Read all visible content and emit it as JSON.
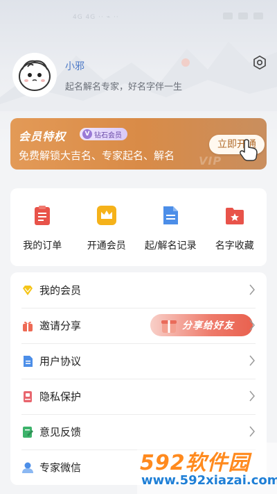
{
  "status_bar": {
    "left_text": "4G  4G  ·· ⌁ ··"
  },
  "profile": {
    "username": "小邪",
    "tagline": "起名解名专家，好名字伴一生"
  },
  "vip_banner": {
    "title": "会员特权",
    "badge": "钻石会员",
    "badge_icon": "V",
    "description": "免费解锁大吉名、专家起名、解名",
    "button": "立即开通",
    "watermark": "VIP"
  },
  "quick_actions": [
    {
      "label": "我的订单",
      "icon": "clipboard-icon",
      "color": "#e8534a"
    },
    {
      "label": "开通会员",
      "icon": "crown-icon",
      "color": "#f5b21a"
    },
    {
      "label": "起/解名记录",
      "icon": "document-icon",
      "color": "#4c8ee8"
    },
    {
      "label": "名字收藏",
      "icon": "folder-star-icon",
      "color": "#e8534a"
    }
  ],
  "menu": {
    "items": [
      {
        "label": "我的会员",
        "icon": "diamond-icon"
      },
      {
        "label": "邀请分享",
        "icon": "gift-icon"
      },
      {
        "label": "用户协议",
        "icon": "document-icon"
      },
      {
        "label": "隐私保护",
        "icon": "privacy-icon"
      },
      {
        "label": "意见反馈",
        "icon": "feedback-icon"
      },
      {
        "label": "专家微信",
        "icon": "user-icon"
      }
    ],
    "share_pill": "分享给好友"
  },
  "watermark": {
    "brand_digits": "592",
    "brand_text": "软件园",
    "url": "www.592xiazai.com"
  }
}
